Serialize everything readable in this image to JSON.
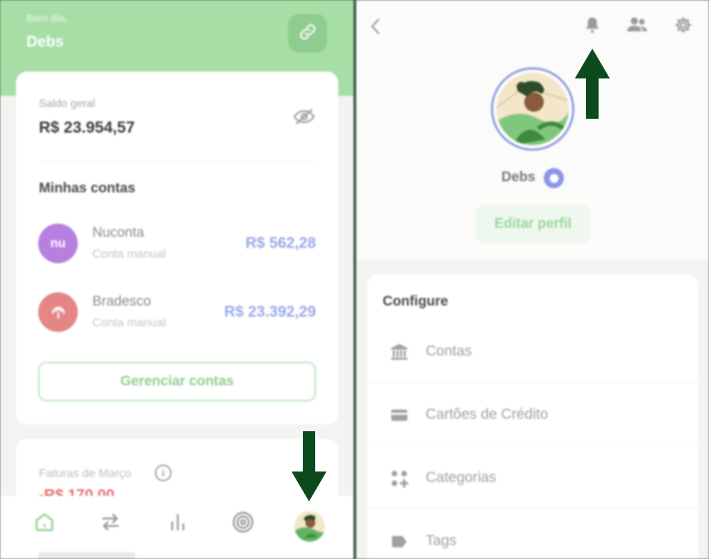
{
  "left": {
    "greeting": "Bom dia,",
    "user_name": "Debs",
    "balance": {
      "label": "Saldo geral",
      "value": "R$ 23.954,57"
    },
    "accounts_title": "Minhas contas",
    "accounts": [
      {
        "logo_text": "nu",
        "name": "Nuconta",
        "type": "Conta manual",
        "balance": "R$ 562,28",
        "color": "#b77fe0"
      },
      {
        "logo_text": "",
        "name": "Bradesco",
        "type": "Conta manual",
        "balance": "R$ 23.392,29",
        "color": "#e58585"
      }
    ],
    "manage_button": "Gerenciar contas",
    "invoices": {
      "label": "Faturas de Março",
      "value": "-R$ 170,00"
    },
    "tabs": [
      "home-icon",
      "transfer-icon",
      "chart-icon",
      "target-icon",
      "profile-avatar"
    ]
  },
  "right": {
    "profile_name": "Debs",
    "edit_button": "Editar perfil",
    "section_title": "Configure",
    "menu": [
      {
        "icon": "bank-icon",
        "label": "Contas"
      },
      {
        "icon": "credit-card-icon",
        "label": "Cartões de Crédito"
      },
      {
        "icon": "categories-icon",
        "label": "Categorias"
      },
      {
        "icon": "tag-icon",
        "label": "Tags"
      }
    ],
    "header_icons": [
      "bell-icon",
      "users-icon",
      "gear-icon"
    ]
  },
  "colors": {
    "header_green": "#a7dea6",
    "accent_green": "#8ed08c",
    "arrow_green": "#0c4a1d",
    "accent_blue": "#8b95e6",
    "negative_red": "#e46f6f"
  }
}
